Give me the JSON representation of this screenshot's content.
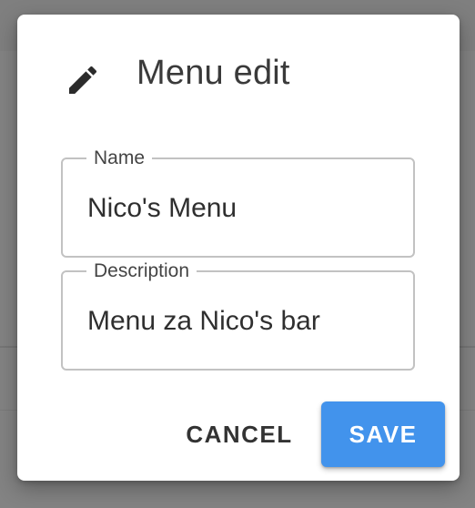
{
  "dialog": {
    "title": "Menu edit",
    "icon": "pencil-icon",
    "fields": {
      "name": {
        "label": "Name",
        "value": "Nico's Menu"
      },
      "description": {
        "label": "Description",
        "value": "Menu za Nico's bar"
      }
    },
    "actions": {
      "cancel_label": "CANCEL",
      "save_label": "SAVE"
    }
  },
  "colors": {
    "primary": "#4293ec",
    "overlay": "#838383",
    "field_border": "#c2c2c2"
  }
}
